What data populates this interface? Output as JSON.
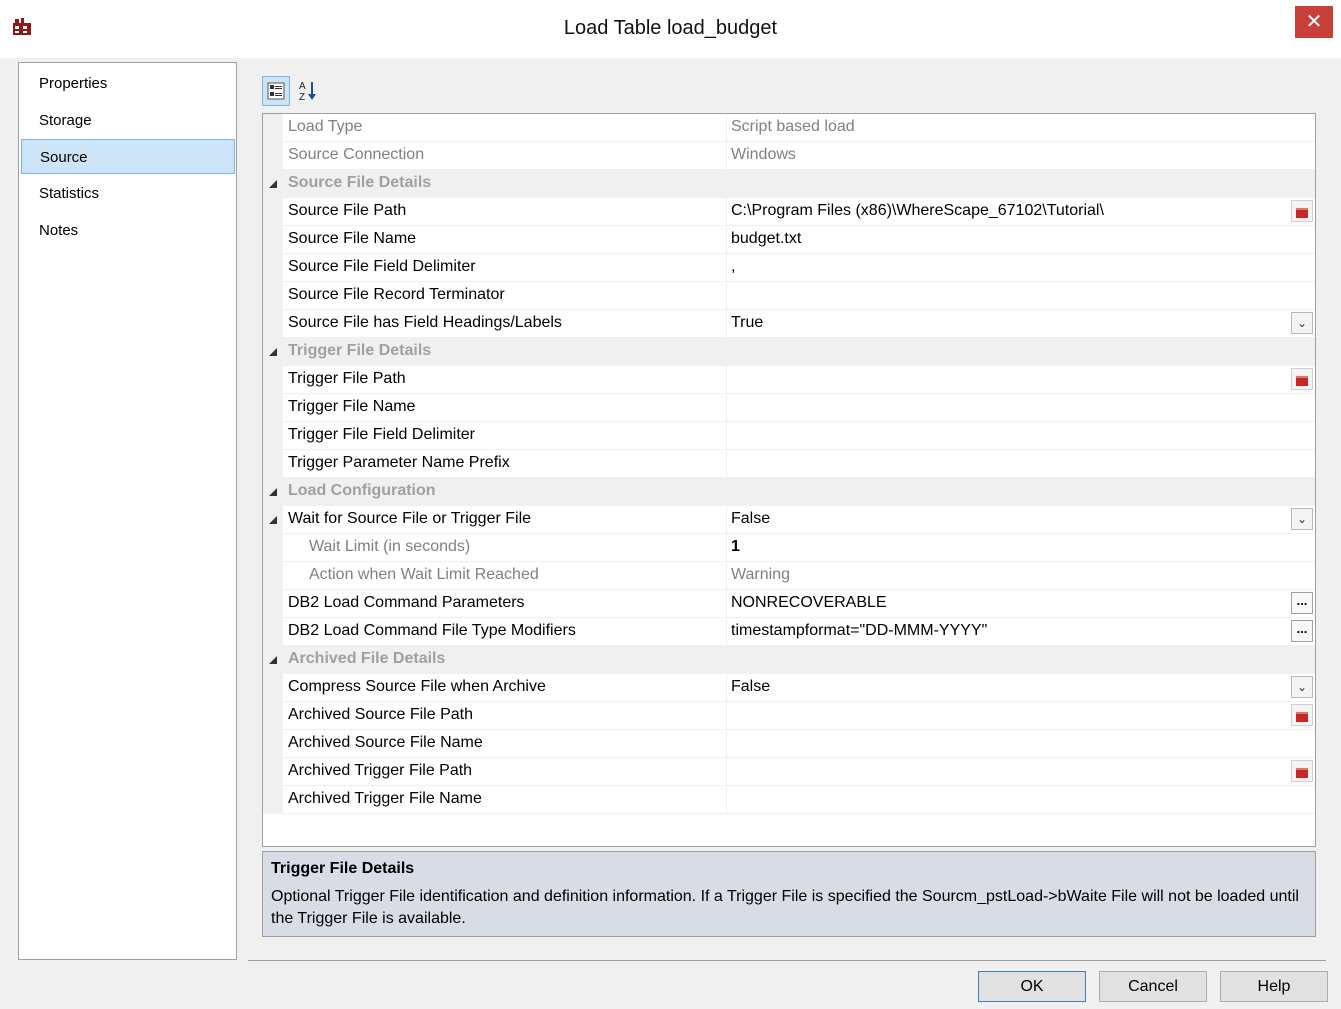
{
  "window": {
    "title": "Load Table load_budget",
    "close_label": "✕",
    "app_icon": "red-brick-app-icon"
  },
  "sidebar": {
    "items": [
      {
        "label": "Properties"
      },
      {
        "label": "Storage"
      },
      {
        "label": "Source",
        "selected": true
      },
      {
        "label": "Statistics"
      },
      {
        "label": "Notes"
      }
    ]
  },
  "toolbar": {
    "categorized": "categorized-view-icon",
    "alphabetical": "sort-alphabetical-icon"
  },
  "grid": {
    "load_type": {
      "name": "Load Type",
      "value": "Script based load"
    },
    "source_connection": {
      "name": "Source Connection",
      "value": "Windows"
    },
    "cat_source": "Source File Details",
    "source_file_path": {
      "name": "Source File Path",
      "value": "C:\\Program Files (x86)\\WhereScape_67102\\Tutorial\\"
    },
    "source_file_name": {
      "name": "Source File Name",
      "value": "budget.txt"
    },
    "source_field_delim": {
      "name": "Source File Field Delimiter",
      "value": ","
    },
    "source_record_term": {
      "name": "Source File Record Terminator",
      "value": ""
    },
    "source_headings": {
      "name": "Source File has Field Headings/Labels",
      "value": "True"
    },
    "cat_trigger": "Trigger File Details",
    "trigger_path": {
      "name": "Trigger File Path",
      "value": ""
    },
    "trigger_name": {
      "name": "Trigger File Name",
      "value": ""
    },
    "trigger_delim": {
      "name": "Trigger File Field Delimiter",
      "value": ""
    },
    "trigger_prefix": {
      "name": "Trigger Parameter Name Prefix",
      "value": ""
    },
    "cat_load": "Load Configuration",
    "wait_for": {
      "name": "Wait for Source File or Trigger File",
      "value": "False"
    },
    "wait_limit": {
      "name": "Wait Limit (in seconds)",
      "value": "1"
    },
    "wait_action": {
      "name": "Action when Wait Limit Reached",
      "value": "Warning"
    },
    "db2_params": {
      "name": "DB2 Load Command Parameters",
      "value": "NONRECOVERABLE"
    },
    "db2_modifiers": {
      "name": "DB2 Load Command File Type Modifiers",
      "value": "timestampformat=\"DD-MMM-YYYY\""
    },
    "cat_archived": "Archived File Details",
    "compress": {
      "name": "Compress Source File when Archive",
      "value": "False"
    },
    "arch_src_path": {
      "name": "Archived Source File Path",
      "value": ""
    },
    "arch_src_name": {
      "name": "Archived Source File Name",
      "value": ""
    },
    "arch_trig_path": {
      "name": "Archived Trigger File Path",
      "value": ""
    },
    "arch_trig_name": {
      "name": "Archived Trigger File Name",
      "value": ""
    },
    "dropdown_glyph": "⌄",
    "ellipsis_glyph": "..."
  },
  "description": {
    "title": "Trigger File Details",
    "text": "Optional Trigger File identification and definition information. If a Trigger File is specified the Sourcm_pstLoad->bWaite File will not be loaded until the Trigger File is available."
  },
  "buttons": {
    "ok": "OK",
    "cancel": "Cancel",
    "help": "Help"
  }
}
